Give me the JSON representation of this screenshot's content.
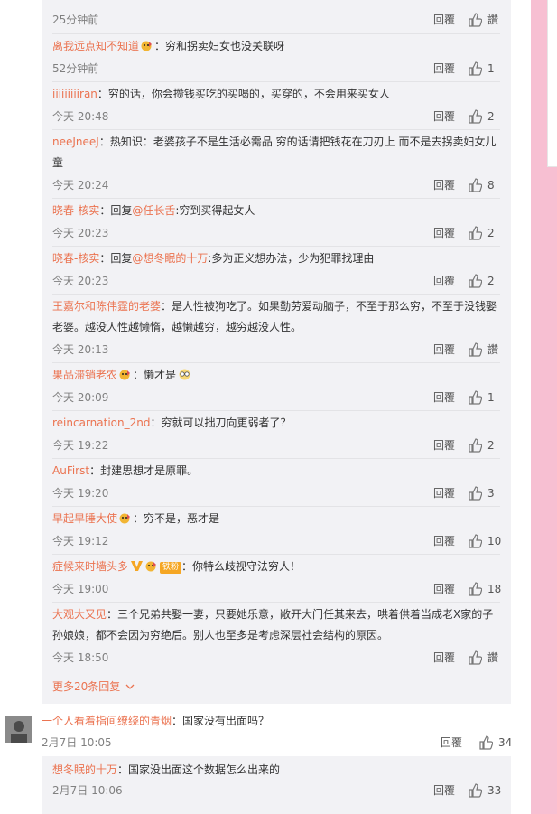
{
  "colors": {
    "username": "#eb7350",
    "text": "#333333",
    "meta": "#808080",
    "reply_bg": "#f2f2f5",
    "sidebar": "#f7bfd2"
  },
  "top_partial": {
    "time": "25分钟前",
    "reply": "回覆",
    "like": "讚"
  },
  "replies": [
    {
      "user": "离我远点知不知道",
      "badge": "emoji",
      "text": "：穷和拐卖妇女也没关联呀",
      "time": "52分钟前",
      "reply": "回覆",
      "likes": "1"
    },
    {
      "user": "iiiiiiiiiran",
      "text": "：穷的话，你会攒钱买吃的买喝的，买穿的，不会用来买女人",
      "time": "今天 20:48",
      "reply": "回覆",
      "likes": "2"
    },
    {
      "user": "neeJneeJ",
      "text": "：热知识：老婆孩子不是生活必需品 穷的话请把钱花在刀刃上 而不是去拐卖妇女儿童",
      "time": "今天 20:24",
      "reply": "回覆",
      "likes": "8"
    },
    {
      "user": "晓春-核实",
      "text_prefix": "：回复",
      "mention": "@任长舌",
      "text": ":穷到买得起女人",
      "time": "今天 20:23",
      "reply": "回覆",
      "likes": "2"
    },
    {
      "user": "晓春-核实",
      "text_prefix": "：回复",
      "mention": "@想冬眠的十万",
      "text": ":多为正义想办法，少为犯罪找理由",
      "time": "今天 20:23",
      "reply": "回覆",
      "likes": "2"
    },
    {
      "user": "王嘉尔和陈伟霆的老婆",
      "text": "：是人性被狗吃了。如果勤劳爱动脑子，不至于那么穷，不至于没钱娶老婆。越没人性越懒惰，越懒越穷，越穷越没人性。",
      "time": "今天 20:13",
      "reply": "回覆",
      "likes": "讚"
    },
    {
      "user": "果品滞销老农",
      "badge": "emoji",
      "text": "：懒才是",
      "time": "今天 20:09",
      "reply": "回覆",
      "likes": "1"
    },
    {
      "user": "reincarnation_2nd",
      "text": "：穷就可以拙刀向更弱者了？",
      "time": "今天 19:22",
      "reply": "回覆",
      "likes": "2"
    },
    {
      "user": "AuFirst",
      "text": "：封建思想才是原罪。",
      "time": "今天 19:20",
      "reply": "回覆",
      "likes": "3"
    },
    {
      "user": "早起早睡大使",
      "badge": "emoji",
      "text": "：穷不是，恶才是",
      "time": "今天 19:12",
      "reply": "回覆",
      "likes": "10"
    },
    {
      "user": "症候来时墙头多",
      "badge": "vip",
      "fan_badge": "铁粉",
      "text": "：你特么歧视守法穷人！",
      "time": "今天 19:00",
      "reply": "回覆",
      "likes": "18"
    },
    {
      "user": "大观大又见",
      "text": "：三个兄弟共娶一妻，只要她乐意，敞开大门任其来去，哄着供着当成老X家的子孙娘娘，都不会因为穷绝后。别人也至多是考虑深层社会结构的原因。",
      "time": "今天 18:50",
      "reply": "回覆",
      "likes": "讚"
    }
  ],
  "more_link": "更多20条回复",
  "main_comment": {
    "user": "一个人看着指间缭绕的青烟",
    "text": "：国家没有出面吗？",
    "time": "2月7日 10:05",
    "reply": "回覆",
    "likes": "34"
  },
  "sub_reply": {
    "user": "想冬眠的十万",
    "text": "：国家没出面这个数据怎么出来的",
    "time": "2月7日 10:06",
    "reply": "回覆",
    "likes": "33"
  }
}
